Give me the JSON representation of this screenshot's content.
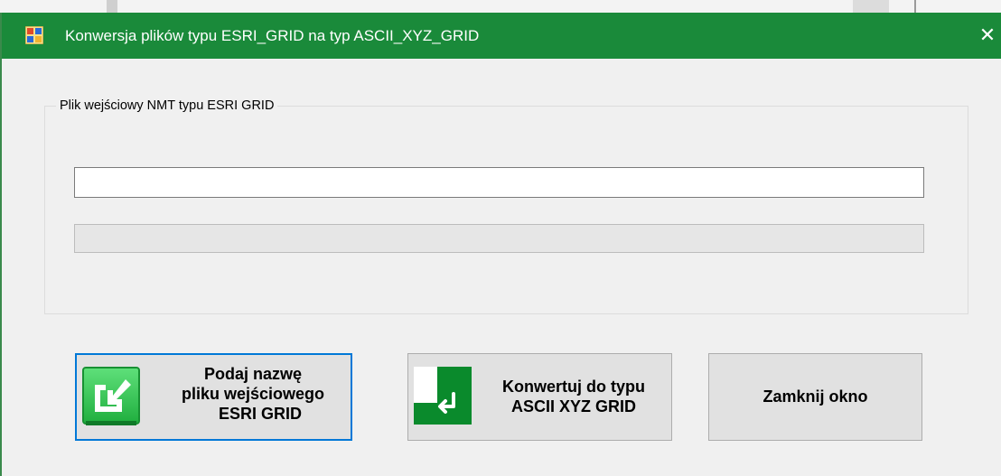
{
  "window": {
    "title": "Konwersja plików typu ESRI_GRID na typ ASCII_XYZ_GRID",
    "close_glyph": "✕",
    "app_icon": "window-app-icon",
    "titlebar_color": "#1a8a3a"
  },
  "group": {
    "legend": "Plik wejściowy NMT typu ESRI GRID"
  },
  "file_input": {
    "value": "",
    "placeholder": ""
  },
  "progress": {
    "value_percent": 0
  },
  "buttons": {
    "open": {
      "line1": "Podaj nazwę",
      "line2": "pliku wejściowego",
      "line3": "ESRI GRID",
      "icon": "import-file-icon"
    },
    "convert": {
      "line1": "Konwertuj do typu",
      "line2": "ASCII XYZ GRID",
      "icon": "enter-arrow-icon"
    },
    "close": {
      "label": "Zamknij okno"
    }
  },
  "colors": {
    "accent_green": "#1a8a3a",
    "icon_green": "#2cc44a",
    "focus_blue": "#0078d7"
  }
}
